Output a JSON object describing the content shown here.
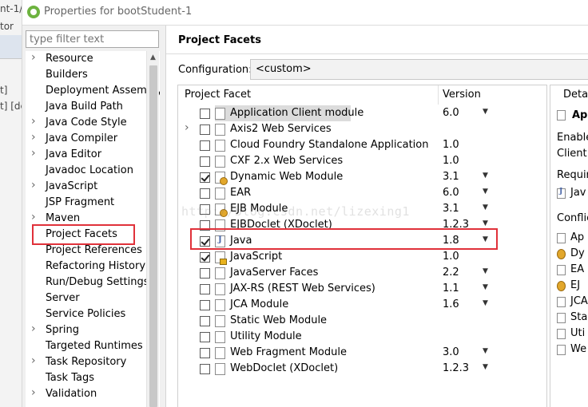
{
  "window": {
    "title": "Properties for bootStudent-1"
  },
  "background": {
    "fragments": [
      "nt-1/",
      "tor",
      "t]",
      "t] [de"
    ]
  },
  "filter": {
    "placeholder": "type filter text"
  },
  "nav": {
    "items": [
      {
        "label": "Resource",
        "expandable": true
      },
      {
        "label": "Builders",
        "expandable": false
      },
      {
        "label": "Deployment Assembly",
        "expandable": false
      },
      {
        "label": "Java Build Path",
        "expandable": false
      },
      {
        "label": "Java Code Style",
        "expandable": true
      },
      {
        "label": "Java Compiler",
        "expandable": true
      },
      {
        "label": "Java Editor",
        "expandable": true
      },
      {
        "label": "Javadoc Location",
        "expandable": false
      },
      {
        "label": "JavaScript",
        "expandable": true
      },
      {
        "label": "JSP Fragment",
        "expandable": false
      },
      {
        "label": "Maven",
        "expandable": true
      },
      {
        "label": "Project Facets",
        "expandable": false
      },
      {
        "label": "Project References",
        "expandable": false
      },
      {
        "label": "Refactoring History",
        "expandable": false
      },
      {
        "label": "Run/Debug Settings",
        "expandable": false
      },
      {
        "label": "Server",
        "expandable": false
      },
      {
        "label": "Service Policies",
        "expandable": false
      },
      {
        "label": "Spring",
        "expandable": true
      },
      {
        "label": "Targeted Runtimes",
        "expandable": false
      },
      {
        "label": "Task Repository",
        "expandable": true
      },
      {
        "label": "Task Tags",
        "expandable": false
      },
      {
        "label": "Validation",
        "expandable": true
      }
    ],
    "selected": "Project Facets"
  },
  "page": {
    "title": "Project Facets",
    "config_label": "Configuration:",
    "config_value": "<custom>"
  },
  "facets": {
    "col_facet": "Project Facet",
    "col_version": "Version",
    "rows": [
      {
        "name": "Application Client module",
        "version": "6.0",
        "checked": false,
        "icon": "",
        "dropdown": true,
        "expandable": false,
        "selected": true
      },
      {
        "name": "Axis2 Web Services",
        "version": "",
        "checked": false,
        "icon": "",
        "dropdown": false,
        "expandable": true,
        "selected": false
      },
      {
        "name": "Cloud Foundry Standalone Application",
        "version": "1.0",
        "checked": false,
        "icon": "",
        "dropdown": false,
        "expandable": false,
        "selected": false
      },
      {
        "name": "CXF 2.x Web Services",
        "version": "1.0",
        "checked": false,
        "icon": "",
        "dropdown": false,
        "expandable": false,
        "selected": false
      },
      {
        "name": "Dynamic Web Module",
        "version": "3.1",
        "checked": true,
        "icon": "gear",
        "dropdown": true,
        "expandable": false,
        "selected": false
      },
      {
        "name": "EAR",
        "version": "6.0",
        "checked": false,
        "icon": "",
        "dropdown": true,
        "expandable": false,
        "selected": false
      },
      {
        "name": "EJB Module",
        "version": "3.1",
        "checked": false,
        "icon": "gear",
        "dropdown": true,
        "expandable": false,
        "selected": false
      },
      {
        "name": "EJBDoclet (XDoclet)",
        "version": "1.2.3",
        "checked": false,
        "icon": "",
        "dropdown": true,
        "expandable": false,
        "selected": false
      },
      {
        "name": "Java",
        "version": "1.8",
        "checked": true,
        "icon": "java",
        "dropdown": true,
        "expandable": false,
        "selected": false
      },
      {
        "name": "JavaScript",
        "version": "1.0",
        "checked": true,
        "icon": "lock",
        "dropdown": false,
        "expandable": false,
        "selected": false
      },
      {
        "name": "JavaServer Faces",
        "version": "2.2",
        "checked": false,
        "icon": "",
        "dropdown": true,
        "expandable": false,
        "selected": false
      },
      {
        "name": "JAX-RS (REST Web Services)",
        "version": "1.1",
        "checked": false,
        "icon": "",
        "dropdown": true,
        "expandable": false,
        "selected": false
      },
      {
        "name": "JCA Module",
        "version": "1.6",
        "checked": false,
        "icon": "",
        "dropdown": true,
        "expandable": false,
        "selected": false
      },
      {
        "name": "Static Web Module",
        "version": "",
        "checked": false,
        "icon": "",
        "dropdown": false,
        "expandable": false,
        "selected": false
      },
      {
        "name": "Utility Module",
        "version": "",
        "checked": false,
        "icon": "",
        "dropdown": false,
        "expandable": false,
        "selected": false
      },
      {
        "name": "Web Fragment Module",
        "version": "3.0",
        "checked": false,
        "icon": "",
        "dropdown": true,
        "expandable": false,
        "selected": false
      },
      {
        "name": "WebDoclet (XDoclet)",
        "version": "1.2.3",
        "checked": false,
        "icon": "",
        "dropdown": true,
        "expandable": false,
        "selected": false
      }
    ]
  },
  "details": {
    "title": "Details",
    "heading": "App",
    "lines": [
      "Enable",
      "Client m"
    ],
    "requires_label": "Require",
    "requires_items": [
      {
        "icon": "java",
        "label": "Jav"
      }
    ],
    "conflicts_label": "Conflict",
    "conflicts_items": [
      {
        "icon": "plain",
        "label": "Ap"
      },
      {
        "icon": "gear",
        "label": "Dy"
      },
      {
        "icon": "plain",
        "label": "EA"
      },
      {
        "icon": "gear",
        "label": "EJ"
      },
      {
        "icon": "plain",
        "label": "JCA"
      },
      {
        "icon": "plain",
        "label": "Sta"
      },
      {
        "icon": "plain",
        "label": "Uti"
      },
      {
        "icon": "plain",
        "label": "We"
      }
    ]
  },
  "watermark": "http://blog.csdn.net/lizexing1"
}
